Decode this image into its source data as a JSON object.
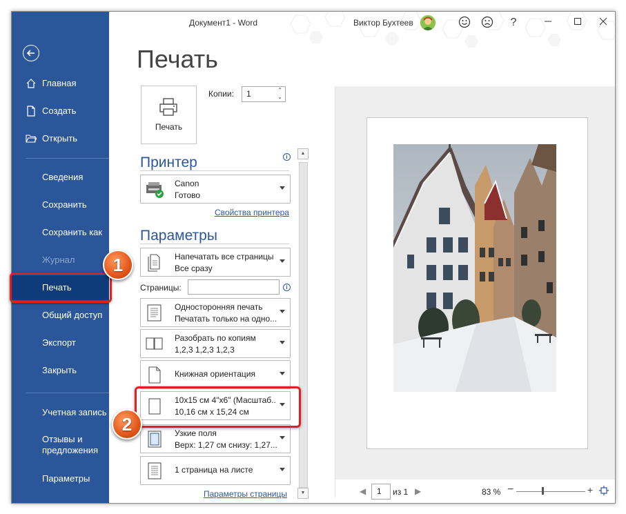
{
  "window": {
    "title": "Документ1  -  Word",
    "user": "Виктор Бухтеев"
  },
  "sidebar": {
    "items": [
      {
        "label": "Главная",
        "icon": "home-icon"
      },
      {
        "label": "Создать",
        "icon": "new-document-icon"
      },
      {
        "label": "Открыть",
        "icon": "folder-open-icon"
      },
      {
        "label": "Сведения"
      },
      {
        "label": "Сохранить"
      },
      {
        "label": "Сохранить как"
      },
      {
        "label": "Журнал",
        "disabled": true
      },
      {
        "label": "Печать",
        "active": true
      },
      {
        "label": "Общий доступ"
      },
      {
        "label": "Экспорт"
      },
      {
        "label": "Закрыть"
      },
      {
        "label": "Учетная запись"
      },
      {
        "label": "Отзывы и",
        "label2": "предложения"
      },
      {
        "label": "Параметры"
      }
    ]
  },
  "main": {
    "title": "Печать",
    "print_button": "Печать",
    "copies_label": "Копии:",
    "copies_value": "1",
    "printer_header": "Принтер",
    "printer": {
      "name": "Canon",
      "status": "Готово"
    },
    "printer_props_link": "Свойства принтера",
    "settings_header": "Параметры",
    "settings": [
      {
        "l1": "Напечатать все страницы",
        "l2": "Все сразу"
      },
      {
        "l1": "Односторонняя печать",
        "l2": "Печатать только на одно..."
      },
      {
        "l1": "Разобрать по копиям",
        "l2": "1,2,3     1,2,3     1,2,3"
      },
      {
        "l1": "Книжная ориентация"
      },
      {
        "l1": "10x15 см 4\"x6\" (Масштаб...",
        "l2": "10,16 см x 15,24 см"
      },
      {
        "l1": "Узкие поля",
        "l2": "Верх: 1,27 см снизу: 1,27..."
      },
      {
        "l1": "1 страница на листе"
      }
    ],
    "pages_label": "Страницы:",
    "pages_value": "",
    "page_setup_link": "Параметры страницы"
  },
  "preview": {
    "current_page": "1",
    "of_label": "из 1",
    "zoom": "83 %",
    "zoom_fraction": 0.38
  },
  "callouts": {
    "first": "1",
    "second": "2"
  },
  "colors": {
    "accent": "#2b579a",
    "sidebar_active": "#0f3b7a",
    "callout": "#e02020",
    "badge": "#e2571b"
  }
}
